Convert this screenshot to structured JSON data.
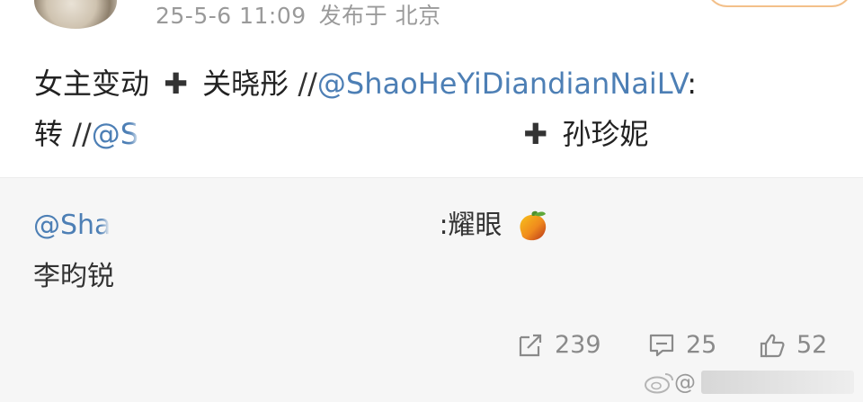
{
  "post": {
    "timestamp": "25-5-6 11:09",
    "location": "发布于 北京",
    "line1": {
      "text_a": "女主变动",
      "plus": "✚",
      "text_b": "关晓彤",
      "slashes": "//",
      "mention": "@ShaoHeYiDiandianNaiLV",
      "colon": ":"
    },
    "line2": {
      "text_a": "转",
      "slashes": "//",
      "mention_visible": "@S",
      "plus": "✚",
      "text_b": "孙珍妮"
    }
  },
  "quote": {
    "mention_visible": "@Sha",
    "text_after": ":耀眼",
    "emoji_icon": "mango-icon",
    "line2": "李昀锐"
  },
  "actions": {
    "repost_count": "239",
    "comment_count": "25",
    "like_count": "52"
  },
  "watermark": {
    "prefix": "@"
  },
  "colors": {
    "mention": "#4d7fb5",
    "meta_text": "#9a9a9a",
    "quote_bg": "#f6f6f6"
  }
}
